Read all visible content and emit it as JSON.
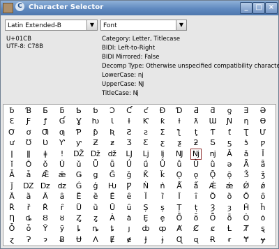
{
  "window": {
    "title": "Character Selector",
    "title_glyph": "C",
    "buttons": [
      "_",
      "□",
      "×"
    ]
  },
  "selectors": {
    "block": "Latin Extended-B",
    "font": "Font",
    "arrow": "▼"
  },
  "codepoint": {
    "unicode": "U+01CB",
    "utf8": "UTF-8: C78B"
  },
  "properties": {
    "category": "Category: Letter, Titlecase",
    "bidi": "BIDI: Left-to-Right",
    "bidi_mirrored": "BIDI Mirrored: False",
    "decomp_type": "Decomp Type: Otherwise unspecified compatibility character.",
    "lowercase": "LowerCase: nj",
    "uppercase": "UpperCase: Ǌ",
    "titlecase": "TitleCase: ǋ"
  },
  "grid": {
    "rows": [
      [
        "ƀ",
        "Ɓ",
        "Ƃ",
        "ƃ",
        "Ƅ",
        "ƅ",
        "Ɔ",
        "Ƈ",
        "ƈ",
        "Ɖ",
        "Ɗ",
        "Ƌ",
        "ƌ",
        "ƍ",
        "Ǝ",
        "Ə"
      ],
      [
        "Ɛ",
        "Ƒ",
        "ƒ",
        "Ɠ",
        "Ɣ",
        "ƕ",
        "Ɩ",
        "Ɨ",
        "Ƙ",
        "ƙ",
        "ƚ",
        "ƛ",
        "Ɯ",
        "Ɲ",
        "ƞ",
        "Ɵ"
      ],
      [
        "Ơ",
        "ơ",
        "Ƣ",
        "ƣ",
        "Ƥ",
        "ƥ",
        "Ʀ",
        "Ƨ",
        "ƨ",
        "Ʃ",
        "ƪ",
        "ƫ",
        "Ƭ",
        "ƭ",
        "Ʈ",
        "Ư"
      ],
      [
        "ư",
        "Ʊ",
        "Ʋ",
        "Ƴ",
        "ƴ",
        "Ƶ",
        "ƶ",
        "Ʒ",
        "Ƹ",
        "ƹ",
        "ƺ",
        "ƻ",
        "Ƽ",
        "ƽ",
        "ƾ",
        "ƿ"
      ],
      [
        "ǀ",
        "ǁ",
        "ǂ",
        "ǃ",
        "Ǆ",
        "ǅ",
        "ǆ",
        "Ǉ",
        "ǈ",
        "ǉ",
        "Ǌ",
        "ǋ",
        "ǌ",
        "Ǎ",
        "ǎ",
        "Ǐ"
      ],
      [
        "ǐ",
        "Ǒ",
        "ǒ",
        "Ǔ",
        "ǔ",
        "Ǖ",
        "ǖ",
        "Ǘ",
        "ǘ",
        "Ǚ",
        "ǚ",
        "Ǜ",
        "ǜ",
        "ǝ",
        "Ǟ",
        "ǟ"
      ],
      [
        "Ǡ",
        "ǡ",
        "Ǣ",
        "ǣ",
        "Ǥ",
        "ǥ",
        "Ǧ",
        "ǧ",
        "Ǩ",
        "ǩ",
        "Ǫ",
        "ǫ",
        "Ǭ",
        "ǭ",
        "Ǯ",
        "ǯ"
      ],
      [
        "ǰ",
        "Ǳ",
        "ǲ",
        "ǳ",
        "Ǵ",
        "ǵ",
        "Ƕ",
        "Ƿ",
        "Ǹ",
        "ǹ",
        "Ǻ",
        "ǻ",
        "Ǽ",
        "ǽ",
        "Ǿ",
        "ǿ"
      ],
      [
        "Ȁ",
        "ȁ",
        "Ȃ",
        "ȃ",
        "Ȅ",
        "ȅ",
        "Ȇ",
        "ȇ",
        "Ȉ",
        "ȉ",
        "Ȋ",
        "ȋ",
        "Ȍ",
        "ȍ",
        "Ȏ",
        "ȏ"
      ],
      [
        "Ȑ",
        "ȑ",
        "Ȓ",
        "ȓ",
        "Ȕ",
        "ȕ",
        "Ȗ",
        "ȗ",
        "Ș",
        "ș",
        "Ț",
        "ț",
        "Ȝ",
        "ȝ",
        "Ȟ",
        "ȟ"
      ],
      [
        "Ƞ",
        "ȡ",
        "Ȣ",
        "ȣ",
        "Ȥ",
        "ȥ",
        "Ȧ",
        "ȧ",
        "Ȩ",
        "ȩ",
        "Ȫ",
        "ȫ",
        "Ȭ",
        "ȭ",
        "Ȯ",
        "ȯ"
      ],
      [
        "Ȱ",
        "ȱ",
        "Ȳ",
        "ȳ",
        "ȴ",
        "ȵ",
        "ȶ",
        "ȷ",
        "ȸ",
        "ȹ",
        "Ⱥ",
        "Ȼ",
        "ȼ",
        "Ƚ",
        "Ⱦ",
        "ȿ"
      ],
      [
        "ɀ",
        "Ɂ",
        "ɂ",
        "Ƀ",
        "Ʉ",
        "Ʌ",
        "Ɇ",
        "ɇ",
        "Ɉ",
        "ɉ",
        "Ɋ",
        "ɋ",
        "Ɍ",
        "ɍ",
        "Ɏ",
        "ɏ"
      ]
    ]
  }
}
